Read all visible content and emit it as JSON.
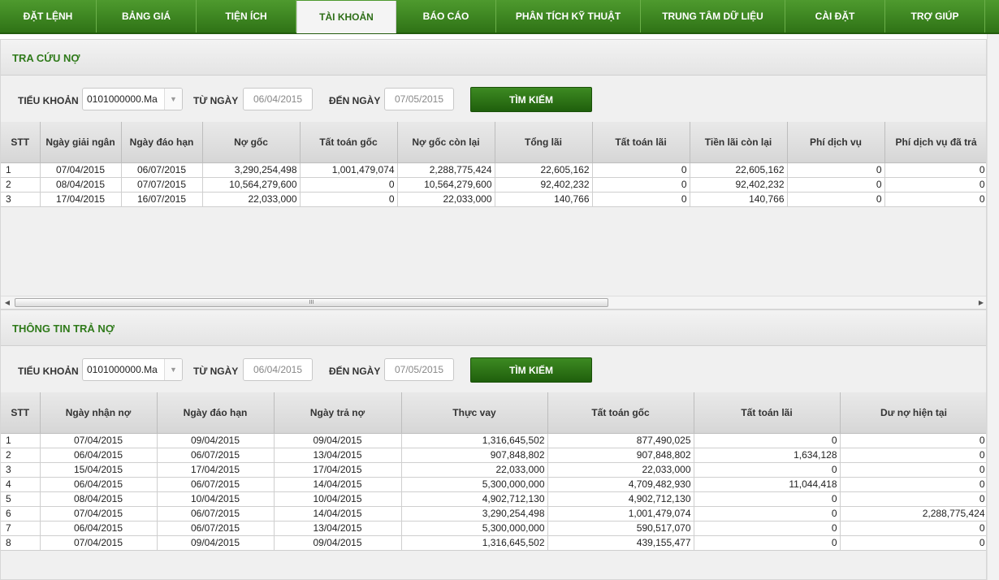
{
  "nav": [
    {
      "label": "ĐẶT LỆNH",
      "active": false
    },
    {
      "label": "BẢNG GIÁ",
      "active": false
    },
    {
      "label": "TIỆN ÍCH",
      "active": false
    },
    {
      "label": "TÀI KHOẢN",
      "active": true
    },
    {
      "label": "BÁO CÁO",
      "active": false
    },
    {
      "label": "PHÂN TÍCH KỸ THUẬT",
      "active": false
    },
    {
      "label": "TRUNG TÂM DỮ LIỆU",
      "active": false
    },
    {
      "label": "CÀI ĐẶT",
      "active": false
    },
    {
      "label": "TRỢ GIÚP",
      "active": false
    }
  ],
  "debt": {
    "title": "TRA CỨU NỢ",
    "filter": {
      "account_label": "TIỂU KHOẢN",
      "account_value": "0101000000.Ma",
      "from_label": "TỪ NGÀY",
      "from_value": "06/04/2015",
      "to_label": "ĐẾN NGÀY",
      "to_value": "07/05/2015",
      "search_label": "TÌM KIẾM"
    },
    "columns": [
      "STT",
      "Ngày giải ngân",
      "Ngày đáo hạn",
      "Nợ gốc",
      "Tất toán gốc",
      "Nợ gốc còn lại",
      "Tổng lãi",
      "Tất toán lãi",
      "Tiền lãi còn lại",
      "Phí dịch vụ",
      "Phí dịch vụ đã trả"
    ],
    "rows": [
      [
        "1",
        "07/04/2015",
        "06/07/2015",
        "3,290,254,498",
        "1,001,479,074",
        "2,288,775,424",
        "22,605,162",
        "0",
        "22,605,162",
        "0",
        "0"
      ],
      [
        "2",
        "08/04/2015",
        "07/07/2015",
        "10,564,279,600",
        "0",
        "10,564,279,600",
        "92,402,232",
        "0",
        "92,402,232",
        "0",
        "0"
      ],
      [
        "3",
        "17/04/2015",
        "16/07/2015",
        "22,033,000",
        "0",
        "22,033,000",
        "140,766",
        "0",
        "140,766",
        "0",
        "0"
      ]
    ],
    "scroll_grip": "III"
  },
  "repay": {
    "title": "THÔNG TIN TRẢ NỢ",
    "filter": {
      "account_label": "TIỂU KHOẢN",
      "account_value": "0101000000.Ma",
      "from_label": "TỪ NGÀY",
      "from_value": "06/04/2015",
      "to_label": "ĐẾN NGÀY",
      "to_value": "07/05/2015",
      "search_label": "TÌM KIẾM"
    },
    "columns": [
      "STT",
      "Ngày nhận nợ",
      "Ngày đáo hạn",
      "Ngày trả nợ",
      "Thực vay",
      "Tất toán gốc",
      "Tất toán lãi",
      "Dư nợ hiện tại"
    ],
    "rows": [
      [
        "1",
        "07/04/2015",
        "09/04/2015",
        "09/04/2015",
        "1,316,645,502",
        "877,490,025",
        "0",
        "0"
      ],
      [
        "2",
        "06/04/2015",
        "06/07/2015",
        "13/04/2015",
        "907,848,802",
        "907,848,802",
        "1,634,128",
        "0"
      ],
      [
        "3",
        "15/04/2015",
        "17/04/2015",
        "17/04/2015",
        "22,033,000",
        "22,033,000",
        "0",
        "0"
      ],
      [
        "4",
        "06/04/2015",
        "06/07/2015",
        "14/04/2015",
        "5,300,000,000",
        "4,709,482,930",
        "11,044,418",
        "0"
      ],
      [
        "5",
        "08/04/2015",
        "10/04/2015",
        "10/04/2015",
        "4,902,712,130",
        "4,902,712,130",
        "0",
        "0"
      ],
      [
        "6",
        "07/04/2015",
        "06/07/2015",
        "14/04/2015",
        "3,290,254,498",
        "1,001,479,074",
        "0",
        "2,288,775,424"
      ],
      [
        "7",
        "06/04/2015",
        "06/07/2015",
        "13/04/2015",
        "5,300,000,000",
        "590,517,070",
        "0",
        "0"
      ],
      [
        "8",
        "07/04/2015",
        "09/04/2015",
        "09/04/2015",
        "1,316,645,502",
        "439,155,477",
        "0",
        "0"
      ]
    ]
  }
}
